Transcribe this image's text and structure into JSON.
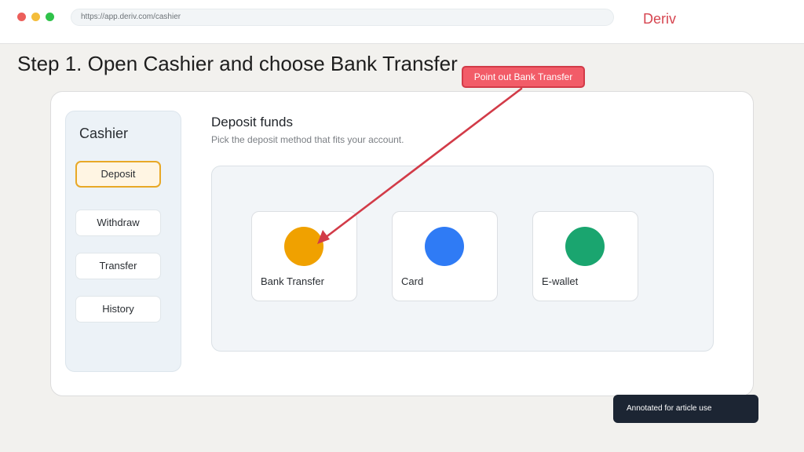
{
  "browser": {
    "url": "https://app.deriv.com/cashier",
    "brand": "Deriv"
  },
  "step_title": "Step 1. Open Cashier and choose Bank Transfer",
  "sidebar": {
    "title": "Cashier",
    "items": [
      {
        "label": "Deposit",
        "active": true
      },
      {
        "label": "Withdraw",
        "active": false
      },
      {
        "label": "Transfer",
        "active": false
      },
      {
        "label": "History",
        "active": false
      }
    ]
  },
  "panel": {
    "title": "Deposit funds",
    "subtitle": "Pick the deposit method that fits your account."
  },
  "methods": [
    {
      "label": "Bank Transfer",
      "color": "#f0a100",
      "icon": "bank-transfer-icon"
    },
    {
      "label": "Card",
      "color": "#2f7bf5",
      "icon": "card-icon"
    },
    {
      "label": "E-wallet",
      "color": "#1aa56f",
      "icon": "e-wallet-icon"
    }
  ],
  "annotation": {
    "callout": "Point out Bank Transfer",
    "arrow_color": "#d23b48"
  },
  "toast": "Annotated for article use"
}
